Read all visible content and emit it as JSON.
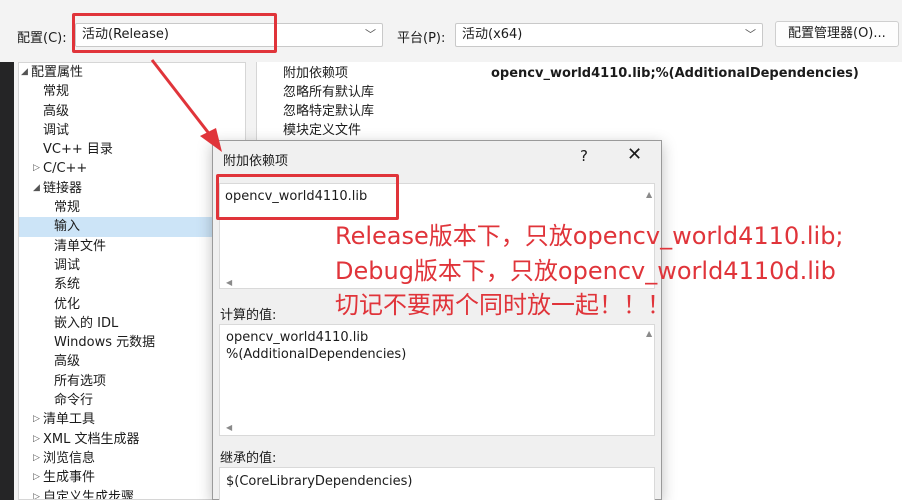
{
  "toolbar": {
    "config_label": "配置(C):",
    "config_value": "活动(Release)",
    "platform_label": "平台(P):",
    "platform_value": "活动(x64)",
    "config_manager_button": "配置管理器(O)..."
  },
  "tree": {
    "items": [
      {
        "label": "配置属性",
        "indent": 0,
        "expander": "collapse"
      },
      {
        "label": "常规",
        "indent": 1
      },
      {
        "label": "高级",
        "indent": 1
      },
      {
        "label": "调试",
        "indent": 1
      },
      {
        "label": "VC++ 目录",
        "indent": 1
      },
      {
        "label": "C/C++",
        "indent": 1,
        "expander": "expand"
      },
      {
        "label": "链接器",
        "indent": 1,
        "expander": "collapse"
      },
      {
        "label": "常规",
        "indent": 2
      },
      {
        "label": "输入",
        "indent": 2,
        "selected": true
      },
      {
        "label": "清单文件",
        "indent": 2
      },
      {
        "label": "调试",
        "indent": 2
      },
      {
        "label": "系统",
        "indent": 2
      },
      {
        "label": "优化",
        "indent": 2
      },
      {
        "label": "嵌入的 IDL",
        "indent": 2
      },
      {
        "label": "Windows 元数据",
        "indent": 2
      },
      {
        "label": "高级",
        "indent": 2
      },
      {
        "label": "所有选项",
        "indent": 2
      },
      {
        "label": "命令行",
        "indent": 2
      },
      {
        "label": "清单工具",
        "indent": 1,
        "expander": "expand"
      },
      {
        "label": "XML 文档生成器",
        "indent": 1,
        "expander": "expand"
      },
      {
        "label": "浏览信息",
        "indent": 1,
        "expander": "expand"
      },
      {
        "label": "生成事件",
        "indent": 1,
        "expander": "expand"
      },
      {
        "label": "自定义生成步骤",
        "indent": 1,
        "expander": "expand"
      }
    ]
  },
  "properties": {
    "rows": [
      {
        "name": "附加依赖项",
        "value": "opencv_world4110.lib;%(AdditionalDependencies)"
      },
      {
        "name": "忽略所有默认库",
        "value": ""
      },
      {
        "name": "忽略特定默认库",
        "value": ""
      },
      {
        "name": "模块定义文件",
        "value": ""
      }
    ]
  },
  "dialog": {
    "title": "附加依赖项",
    "help": "?",
    "close": "✕",
    "edit_value": "opencv_world4110.lib",
    "computed_label": "计算的值:",
    "computed_lines": [
      "opencv_world4110.lib",
      "%(AdditionalDependencies)"
    ],
    "inherited_label": "继承的值:",
    "inherited_lines": [
      "$(CoreLibraryDependencies)"
    ]
  },
  "annotation": {
    "lines": [
      "Release版本下，只放opencv_world4110.lib;",
      "Debug版本下，只放opencv_world4110d.lib",
      "切记不要两个同时放一起！！！"
    ],
    "color": "#e0343a"
  }
}
